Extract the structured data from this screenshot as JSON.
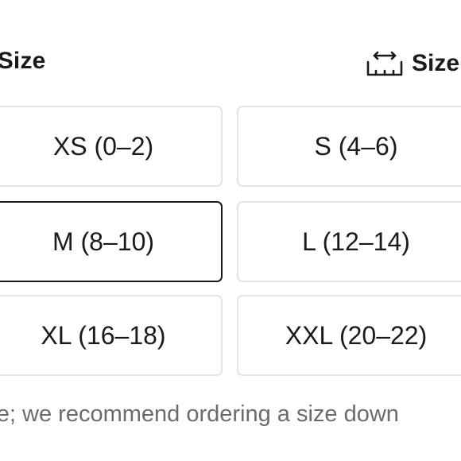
{
  "heading": "t Size",
  "size_guide": {
    "label": "Size",
    "icon": "ruler-measure-icon"
  },
  "sizes": [
    {
      "label": "XS (0–2)",
      "selected": false
    },
    {
      "label": "S (4–6)",
      "selected": false
    },
    {
      "label": "M (8–10)",
      "selected": true
    },
    {
      "label": "L (12–14)",
      "selected": false
    },
    {
      "label": "XL (16–18)",
      "selected": false
    },
    {
      "label": "XXL (20–22)",
      "selected": false
    }
  ],
  "note": "rge; we recommend ordering a size down",
  "colors": {
    "text": "#1a1a1a",
    "border": "#e4e4e4",
    "selected_border": "#1a1a1a",
    "muted_text": "#6b6b6b"
  }
}
